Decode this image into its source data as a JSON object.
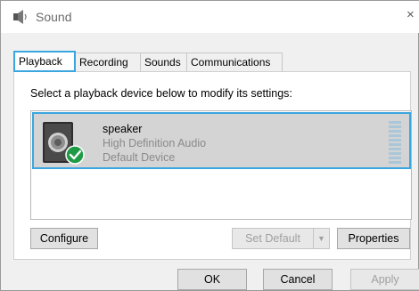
{
  "window": {
    "title": "Sound",
    "close_label": "×"
  },
  "tabs": [
    {
      "label": "Playback",
      "active": true
    },
    {
      "label": "Recording",
      "active": false
    },
    {
      "label": "Sounds",
      "active": false
    },
    {
      "label": "Communications",
      "active": false
    }
  ],
  "playback": {
    "instruction": "Select a playback device below to modify its settings:",
    "devices": [
      {
        "name": "speaker",
        "driver": "High Definition Audio",
        "status": "Default Device",
        "icon": "speaker-icon",
        "badge": "check-icon",
        "selected": true
      }
    ]
  },
  "buttons": {
    "configure": "Configure",
    "set_default": "Set Default",
    "set_default_arrow": "▼",
    "properties": "Properties",
    "ok": "OK",
    "cancel": "Cancel",
    "apply": "Apply"
  },
  "colors": {
    "accent": "#3aa6df",
    "selection_bg": "#d4d4d4",
    "badge_green": "#1f9b45"
  }
}
